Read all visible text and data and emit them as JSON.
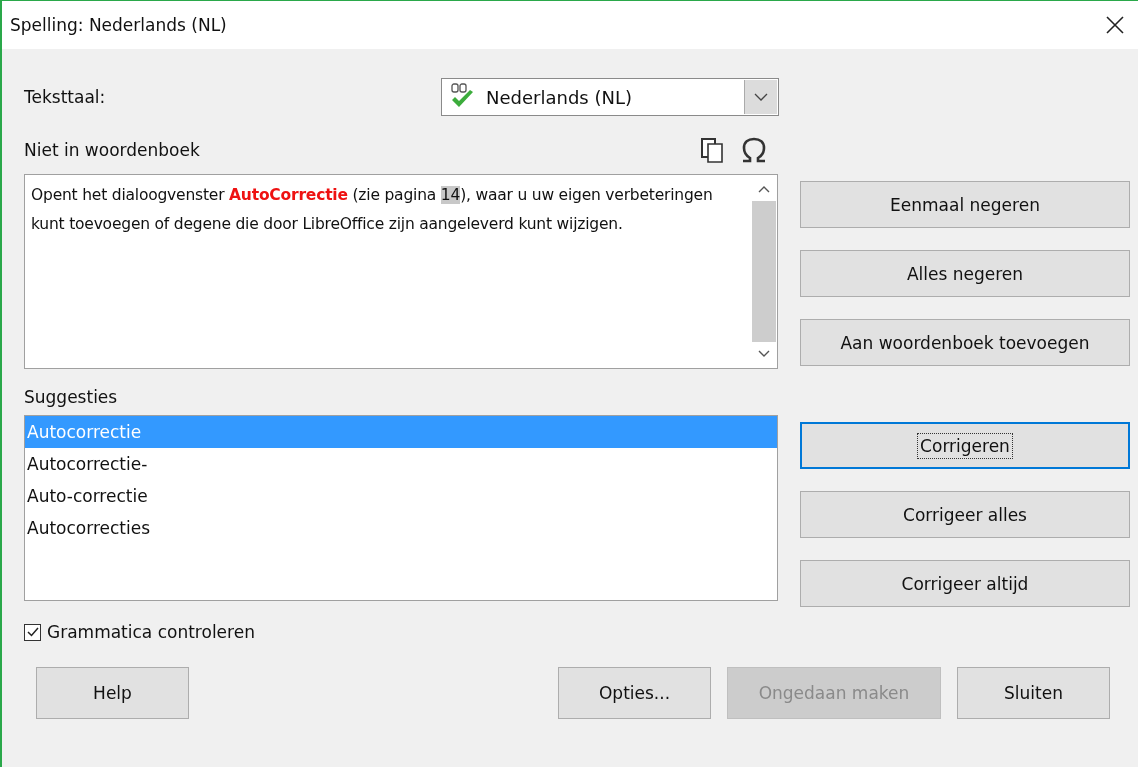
{
  "window": {
    "title": "Spelling: Nederlands (NL)"
  },
  "language": {
    "label": "Teksttaal:",
    "value": "Nederlands (NL)"
  },
  "not_in_dictionary": {
    "label": "Niet in woordenboek",
    "segments": [
      {
        "kind": "plain",
        "text": "Opent het dialoogvenster "
      },
      {
        "kind": "error",
        "text": "AutoCorrectie"
      },
      {
        "kind": "plain",
        "text": " (zie pagina "
      },
      {
        "kind": "field",
        "text": "14"
      },
      {
        "kind": "plain",
        "text": "), waar u uw eigen verbeteringen kunt toevoegen of degene die door LibreOffice zijn aangeleverd kunt wijzigen."
      }
    ]
  },
  "ignore_buttons": [
    {
      "label": "Eenmaal negeren",
      "focused": false
    },
    {
      "label": "Alles negeren",
      "focused": false
    },
    {
      "label": "Aan woordenboek toevoegen",
      "focused": false
    }
  ],
  "correct_buttons": [
    {
      "label": "Corrigeren",
      "focused": true
    },
    {
      "label": "Corrigeer alles",
      "focused": false
    },
    {
      "label": "Corrigeer altijd",
      "focused": false
    }
  ],
  "suggestions": {
    "label": "Suggesties",
    "items": [
      {
        "text": "Autocorrectie",
        "selected": true
      },
      {
        "text": "Autocorrectie-",
        "selected": false
      },
      {
        "text": "Auto-correctie",
        "selected": false
      },
      {
        "text": "Autocorrecties",
        "selected": false
      }
    ]
  },
  "grammar_check": {
    "label": "Grammatica controleren",
    "checked": true
  },
  "help_button": {
    "label": "Help"
  },
  "dialog_buttons": [
    {
      "label": "Opties...",
      "disabled": false
    },
    {
      "label": "Ongedaan maken",
      "disabled": true
    },
    {
      "label": "Sluiten",
      "disabled": false
    }
  ]
}
